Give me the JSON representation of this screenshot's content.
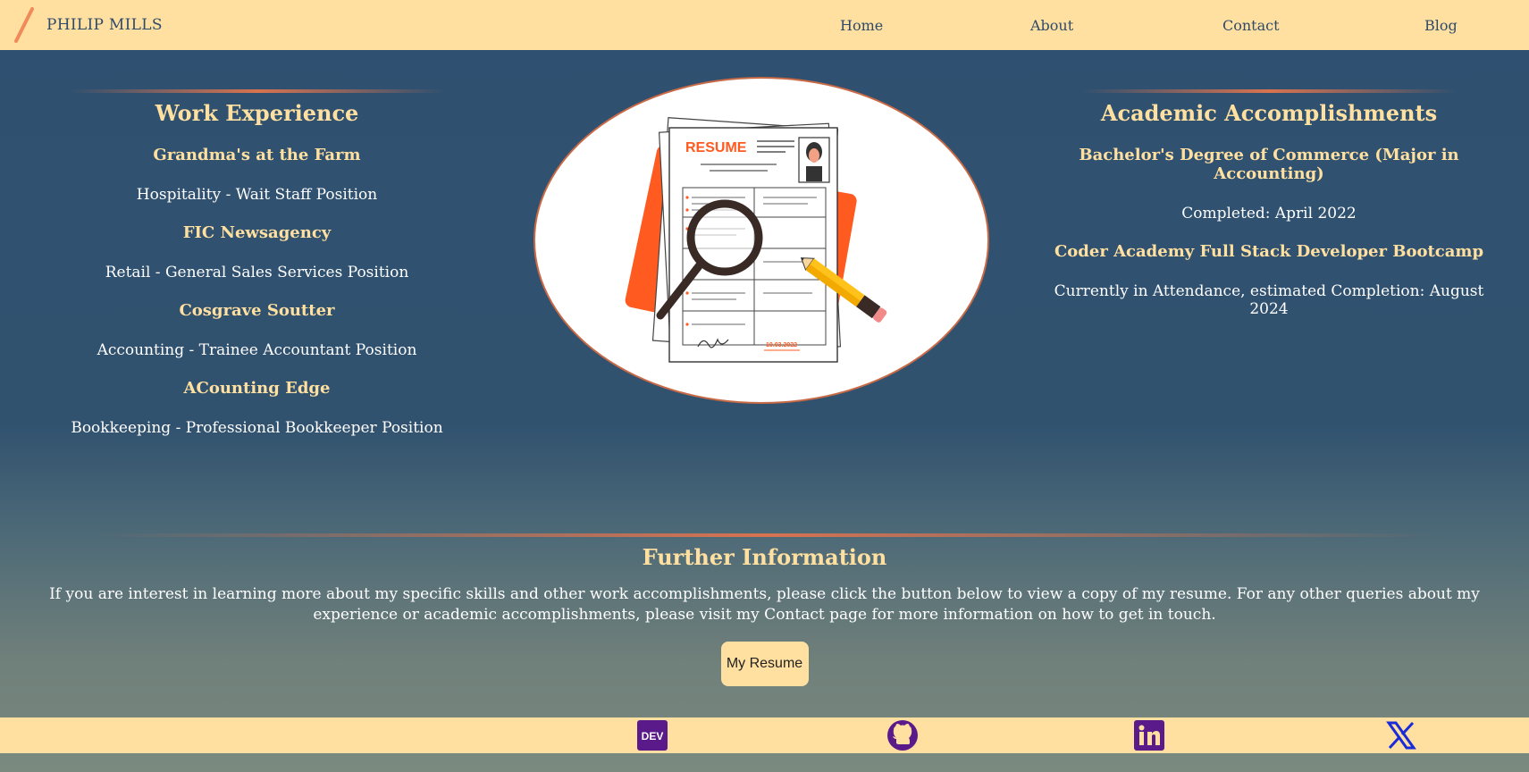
{
  "header": {
    "brand_name": "PHILIP MILLS",
    "nav": [
      {
        "label": "Home"
      },
      {
        "label": "About"
      },
      {
        "label": "Contact"
      },
      {
        "label": "Blog"
      }
    ]
  },
  "work": {
    "title": "Work Experience",
    "items": [
      {
        "title": "Grandma's at the Farm",
        "desc": "Hospitality - Wait Staff Position"
      },
      {
        "title": "FIC Newsagency",
        "desc": "Retail - General Sales Services Position"
      },
      {
        "title": "Cosgrave Soutter",
        "desc": "Accounting - Trainee Accountant Position"
      },
      {
        "title": "ACounting Edge",
        "desc": "Bookkeeping - Professional Bookkeeper Position"
      }
    ]
  },
  "academic": {
    "title": "Academic Accomplishments",
    "items": [
      {
        "title": "Bachelor's Degree of Commerce (Major in Accounting)",
        "desc": "Completed: April 2022"
      },
      {
        "title": "Coder Academy Full Stack Developer Bootcamp",
        "desc": "Currently in Attendance, estimated Completion: August 2024"
      }
    ]
  },
  "hero": {
    "resume_word": "RESUME",
    "date_text": "10.03.2022"
  },
  "further": {
    "title": "Further Information",
    "text": "If you are interest in learning more about my specific skills and other work accomplishments, please click the button below to view a copy of my resume. For any other queries about my experience or academic accomplishments, please visit my Contact page for more information on how to get in touch.",
    "button_label": "My Resume"
  },
  "footer": {
    "dev_icon_label": "DEV",
    "socials": [
      "dev-icon",
      "github-icon",
      "linkedin-icon",
      "x-icon"
    ]
  },
  "colors": {
    "accent": "#ffe0a0",
    "background": "#2f5070",
    "divider": "#d87350",
    "nav_text": "#2f4a6a"
  }
}
